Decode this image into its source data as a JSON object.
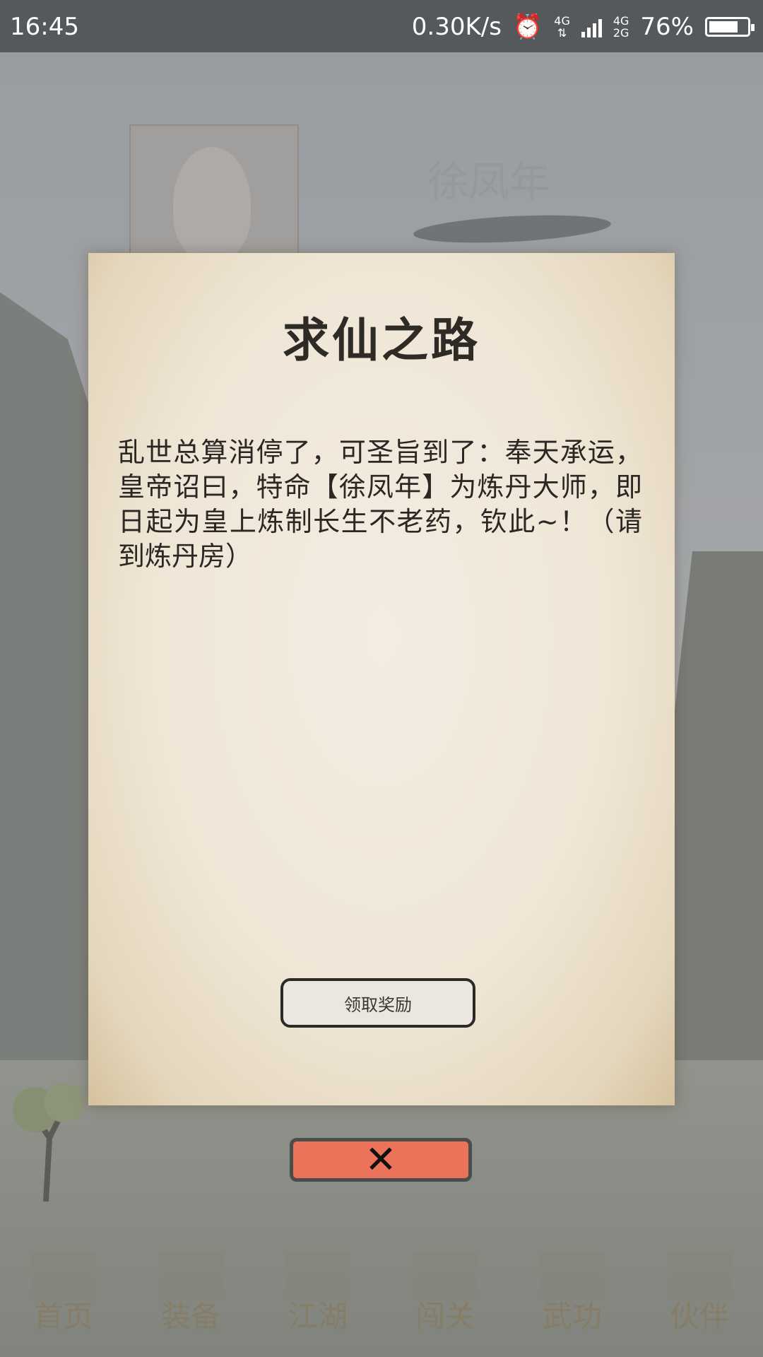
{
  "status_bar": {
    "time": "16:45",
    "net_speed": "0.30K/s",
    "net_type_top": "4G",
    "net_type_bottom": "2G",
    "net_type_left": "4G",
    "battery": "76%",
    "battery_level": 0.76
  },
  "background": {
    "character_name": "徐凤年"
  },
  "dialog": {
    "title": "求仙之路",
    "body": "乱世总算消停了，可圣旨到了：奉天承运，皇帝诏曰，特命【徐凤年】为炼丹大师，即日起为皇上炼制长生不老药，钦此~！（请到炼丹房）",
    "claim_button": "领取奖励",
    "close_icon": "close-x-icon"
  },
  "bottom_nav": {
    "items": [
      {
        "label": "首页"
      },
      {
        "label": "装备"
      },
      {
        "label": "江湖"
      },
      {
        "label": "闯关"
      },
      {
        "label": "武功"
      },
      {
        "label": "伙伴"
      }
    ]
  }
}
